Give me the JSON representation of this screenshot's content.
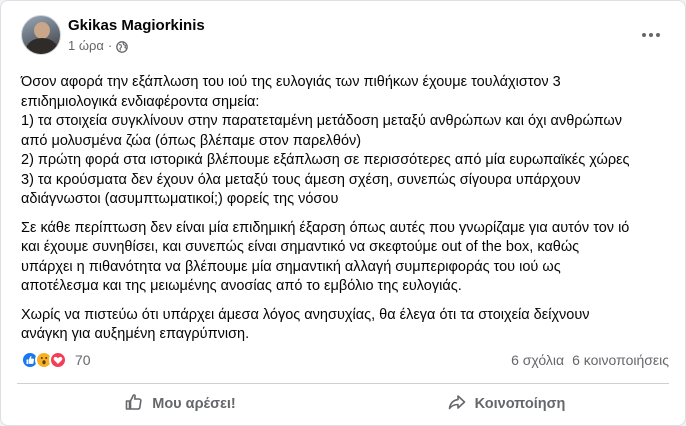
{
  "post": {
    "author": "Gkikas Magiorkinis",
    "time": "1 ώρα",
    "separator": "·",
    "paragraphs": [
      [
        "Όσον αφορά την εξάπλωση του ιού της ευλογιάς των πιθήκων έχουμε τουλάχιστον 3",
        "επιδημιολογικά ενδιαφέροντα σημεία:",
        "1) τα στοιχεία συγκλίνουν στην παρατεταμένη μετάδοση μεταξύ ανθρώπων και όχι ανθρώπων",
        "από μολυσμένα ζώα (όπως βλέπαμε στον παρελθόν)",
        "2) πρώτη φορά στα ιστορικά βλέπουμε εξάπλωση σε περισσότερες από μία ευρωπαϊκές χώρες",
        "3) τα κρούσματα δεν έχουν όλα μεταξύ τους άμεση σχέση, συνεπώς σίγουρα υπάρχουν",
        "αδιάγνωστοι (ασυμπτωματικοί;) φορείς της νόσου"
      ],
      [
        "Σε κάθε περίπτωση δεν είναι μία επιδημική έξαρση όπως αυτές που γνωρίζαμε για αυτόν τον ιό",
        "και έχουμε συνηθίσει, και συνεπώς είναι σημαντικό να σκεφτούμε out of the box, καθώς",
        "υπάρχει η πιθανότητα να βλέπουμε μία σημαντική αλλαγή συμπεριφοράς του ιού ως",
        "αποτέλεσμα και της μειωμένης ανοσίας από το εμβόλιο της ευλογιάς."
      ],
      [
        "Χωρίς να πιστεύω ότι υπάρχει άμεσα λόγος ανησυχίας, θα έλεγα ότι τα στοιχεία δείχνουν",
        "ανάγκη για αυξημένη επαγρύπνιση."
      ]
    ]
  },
  "reactions": {
    "icons": [
      "like-icon",
      "wow-icon",
      "love-icon"
    ],
    "count": "70",
    "comments": "6 σχόλια",
    "shares": "6 κοινοποιήσεις"
  },
  "actions": {
    "like_label": "Μου αρέσει!",
    "share_label": "Κοινοποίηση"
  },
  "colors": {
    "like": "#1877f2",
    "wow": "#f7b125",
    "love": "#f33e58",
    "secondary_text": "#65676b"
  }
}
